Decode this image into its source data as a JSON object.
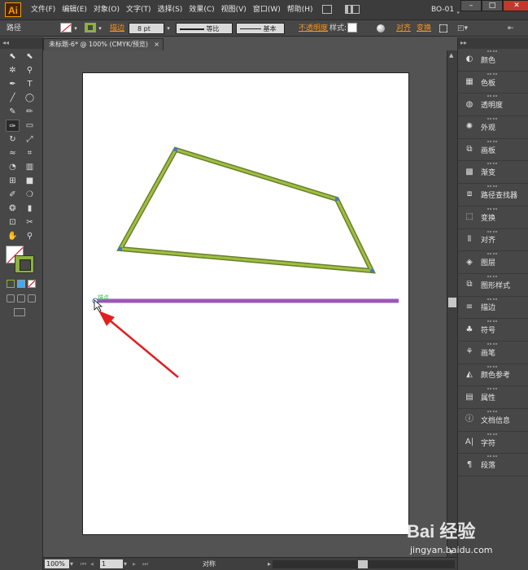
{
  "menubar": {
    "logo": "Ai",
    "menus": [
      "文件(F)",
      "编辑(E)",
      "对象(O)",
      "文字(T)",
      "选择(S)",
      "效果(C)",
      "视图(V)",
      "窗口(W)",
      "帮助(H)"
    ],
    "workspace": "BO-01 ˬ"
  },
  "controlbar": {
    "label": "路径",
    "stroke_label": "描边",
    "stroke_weight": "8 pt",
    "profile1": "等比",
    "profile2": "基本",
    "opacity_link": "不透明度",
    "style_label": "样式:",
    "align_link": "对齐",
    "transform_link": "变换"
  },
  "document": {
    "tab_title": "未标题-6* @ 100% (CMYK/预览)",
    "close": "×"
  },
  "statusbar": {
    "zoom": "100%",
    "page": "1",
    "status": "对称"
  },
  "tools": [
    [
      "selection-tool",
      "direct-selection-tool"
    ],
    [
      "magic-wand-tool",
      "lasso-tool"
    ],
    [
      "pen-tool",
      "type-tool"
    ],
    [
      "line-tool",
      "ellipse-tool"
    ],
    [
      "paintbrush-tool",
      "pencil-tool"
    ],
    [
      "blob-brush-tool",
      "eraser-tool"
    ],
    [
      "rotate-tool",
      "scale-tool"
    ],
    [
      "width-tool",
      "free-transform-tool"
    ],
    [
      "shape-builder-tool",
      "perspective-grid-tool"
    ],
    [
      "mesh-tool",
      "gradient-tool"
    ],
    [
      "eyedropper-tool",
      "blend-tool"
    ],
    [
      "symbol-sprayer-tool",
      "column-graph-tool"
    ],
    [
      "artboard-tool",
      "slice-tool"
    ],
    [
      "hand-tool",
      "zoom-tool"
    ]
  ],
  "tool_glyphs": [
    [
      "⬉",
      "⬉"
    ],
    [
      "✲",
      "⚲"
    ],
    [
      "✒",
      "T"
    ],
    [
      "╱",
      "◯"
    ],
    [
      "✎",
      "✏"
    ],
    [
      "✑",
      "▭"
    ],
    [
      "↻",
      "⤢"
    ],
    [
      "≈",
      "⌗"
    ],
    [
      "◔",
      "▥"
    ],
    [
      "⊞",
      "■"
    ],
    [
      "✐",
      "❍"
    ],
    [
      "❂",
      "▮"
    ],
    [
      "⊡",
      "✂"
    ],
    [
      "✋",
      "⚲"
    ]
  ],
  "colors": {
    "stroke_green": "#8db33a",
    "line_purple": "#9b59b6",
    "arrow_red": "#e02020",
    "panel_bg": "#474747",
    "accent_orange": "#f7941d"
  },
  "panels": [
    {
      "label": "颜色",
      "icon": "color-icon",
      "glyph": "◐"
    },
    {
      "label": "色板",
      "icon": "swatches-icon",
      "glyph": "▦"
    },
    {
      "label": "透明度",
      "icon": "transparency-icon",
      "glyph": "◍"
    },
    {
      "label": "外观",
      "icon": "appearance-icon",
      "glyph": "✺"
    },
    {
      "label": "画板",
      "icon": "artboards-icon",
      "glyph": "⧉"
    },
    {
      "label": "渐变",
      "icon": "gradient-icon",
      "glyph": "▩"
    },
    {
      "label": "路径查找器",
      "icon": "pathfinder-icon",
      "glyph": "⧈"
    },
    {
      "label": "变换",
      "icon": "transform-icon",
      "glyph": "⬚"
    },
    {
      "label": "对齐",
      "icon": "align-icon",
      "glyph": "⫴"
    },
    {
      "label": "图层",
      "icon": "layers-icon",
      "glyph": "◈"
    },
    {
      "label": "图形样式",
      "icon": "graphic-styles-icon",
      "glyph": "⧉"
    },
    {
      "label": "描边",
      "icon": "stroke-icon",
      "glyph": "≡"
    },
    {
      "label": "符号",
      "icon": "symbols-icon",
      "glyph": "♣"
    },
    {
      "label": "画笔",
      "icon": "brushes-icon",
      "glyph": "⚘"
    },
    {
      "label": "颜色参考",
      "icon": "color-guide-icon",
      "glyph": "◭"
    },
    {
      "label": "属性",
      "icon": "attributes-icon",
      "glyph": "▤"
    },
    {
      "label": "文档信息",
      "icon": "document-info-icon",
      "glyph": "ⓘ"
    },
    {
      "label": "字符",
      "icon": "character-icon",
      "glyph": "A|"
    },
    {
      "label": "段落",
      "icon": "paragraph-icon",
      "glyph": "¶"
    }
  ],
  "watermark": {
    "logo": "Bai 经验",
    "url": "jingyan.baidu.com"
  }
}
